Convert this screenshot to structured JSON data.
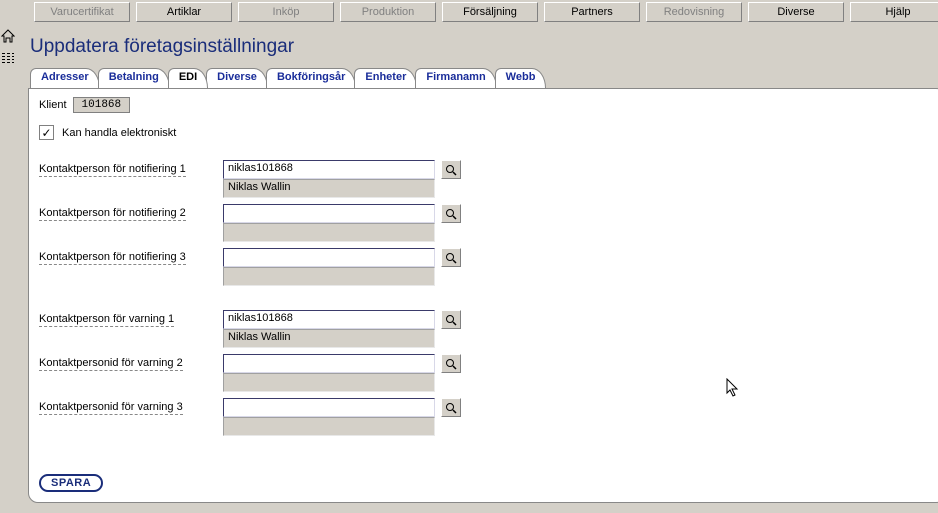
{
  "topnav": [
    {
      "label": "Varucertifikat",
      "disabled": true
    },
    {
      "label": "Artiklar",
      "disabled": false
    },
    {
      "label": "Inköp",
      "disabled": true
    },
    {
      "label": "Produktion",
      "disabled": true
    },
    {
      "label": "Försäljning",
      "disabled": false
    },
    {
      "label": "Partners",
      "disabled": false
    },
    {
      "label": "Redovisning",
      "disabled": true
    },
    {
      "label": "Diverse",
      "disabled": false
    },
    {
      "label": "Hjälp",
      "disabled": false
    }
  ],
  "page_title": "Uppdatera företagsinställningar",
  "tabs": [
    {
      "label": "Adresser",
      "active": false
    },
    {
      "label": "Betalning",
      "active": false
    },
    {
      "label": "EDI",
      "active": true
    },
    {
      "label": "Diverse",
      "active": false
    },
    {
      "label": "Bokföringsår",
      "active": false
    },
    {
      "label": "Enheter",
      "active": false
    },
    {
      "label": "Firmanamn",
      "active": false
    },
    {
      "label": "Webb",
      "active": false
    }
  ],
  "klient": {
    "label": "Klient",
    "value": "101868"
  },
  "checkbox": {
    "checked": true,
    "label": "Kan handla elektroniskt"
  },
  "fields": {
    "notif1": {
      "label": "Kontaktperson för notifiering 1",
      "value": "niklas101868",
      "display": "Niklas Wallin"
    },
    "notif2": {
      "label": "Kontaktperson för notifiering 2",
      "value": "",
      "display": ""
    },
    "notif3": {
      "label": "Kontaktperson för notifiering 3",
      "value": "",
      "display": ""
    },
    "warn1": {
      "label": "Kontaktperson för varning 1",
      "value": "niklas101868",
      "display": "Niklas Wallin"
    },
    "warn2": {
      "label": "Kontaktpersonid för varning 2",
      "value": "",
      "display": ""
    },
    "warn3": {
      "label": "Kontaktpersonid för varning 3",
      "value": "",
      "display": ""
    }
  },
  "save_label": "SPARA",
  "checkmark": "✓"
}
